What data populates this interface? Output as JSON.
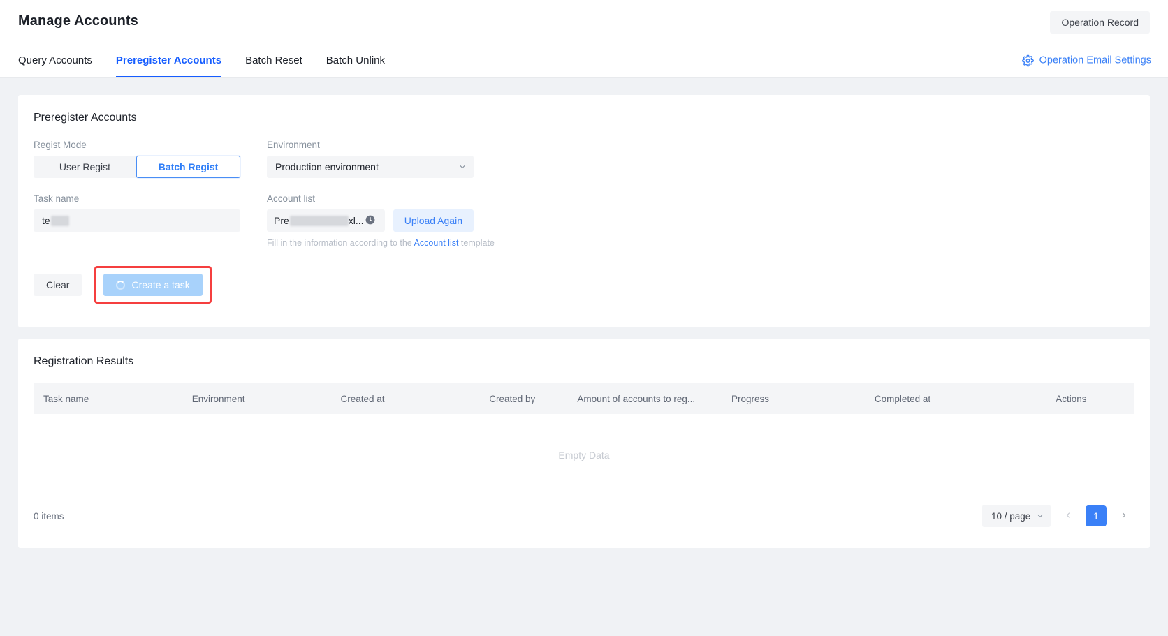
{
  "header": {
    "title": "Manage Accounts",
    "operation_record_label": "Operation Record"
  },
  "tabs": [
    {
      "label": "Query Accounts",
      "active": false
    },
    {
      "label": "Preregister Accounts",
      "active": true
    },
    {
      "label": "Batch Reset",
      "active": false
    },
    {
      "label": "Batch Unlink",
      "active": false
    }
  ],
  "email_settings": {
    "label": "Operation Email Settings",
    "icon": "gear-icon"
  },
  "preregister": {
    "card_title": "Preregister Accounts",
    "regist_mode": {
      "label": "Regist Mode",
      "options": [
        "User Regist",
        "Batch Regist"
      ],
      "selected": "Batch Regist"
    },
    "environment": {
      "label": "Environment",
      "value": "Production environment"
    },
    "task_name": {
      "label": "Task name",
      "value": "te"
    },
    "account_list": {
      "label": "Account list",
      "file_prefix": "Pre",
      "file_suffix": "xl...",
      "status_icon": "clock-icon",
      "upload_label": "Upload Again",
      "hint_before": "Fill in the information according to the ",
      "hint_link": "Account list",
      "hint_after": " template"
    },
    "buttons": {
      "clear_label": "Clear",
      "create_label": "Create a task",
      "create_loading": true
    }
  },
  "results": {
    "card_title": "Registration Results",
    "columns": [
      "Task name",
      "Environment",
      "Created at",
      "Created by",
      "Amount of accounts to reg...",
      "Progress",
      "Completed at",
      "Actions"
    ],
    "rows": [],
    "empty_text": "Empty Data",
    "pagination": {
      "items_text": "0 items",
      "page_size": "10 / page",
      "current_page": "1",
      "prev_icon": "chevron-left-icon",
      "next_icon": "chevron-right-icon"
    }
  },
  "colors": {
    "accent": "#165dff",
    "link": "#3a80f7",
    "highlight": "#f53f3f",
    "disabled_button": "#a8d2fb"
  }
}
